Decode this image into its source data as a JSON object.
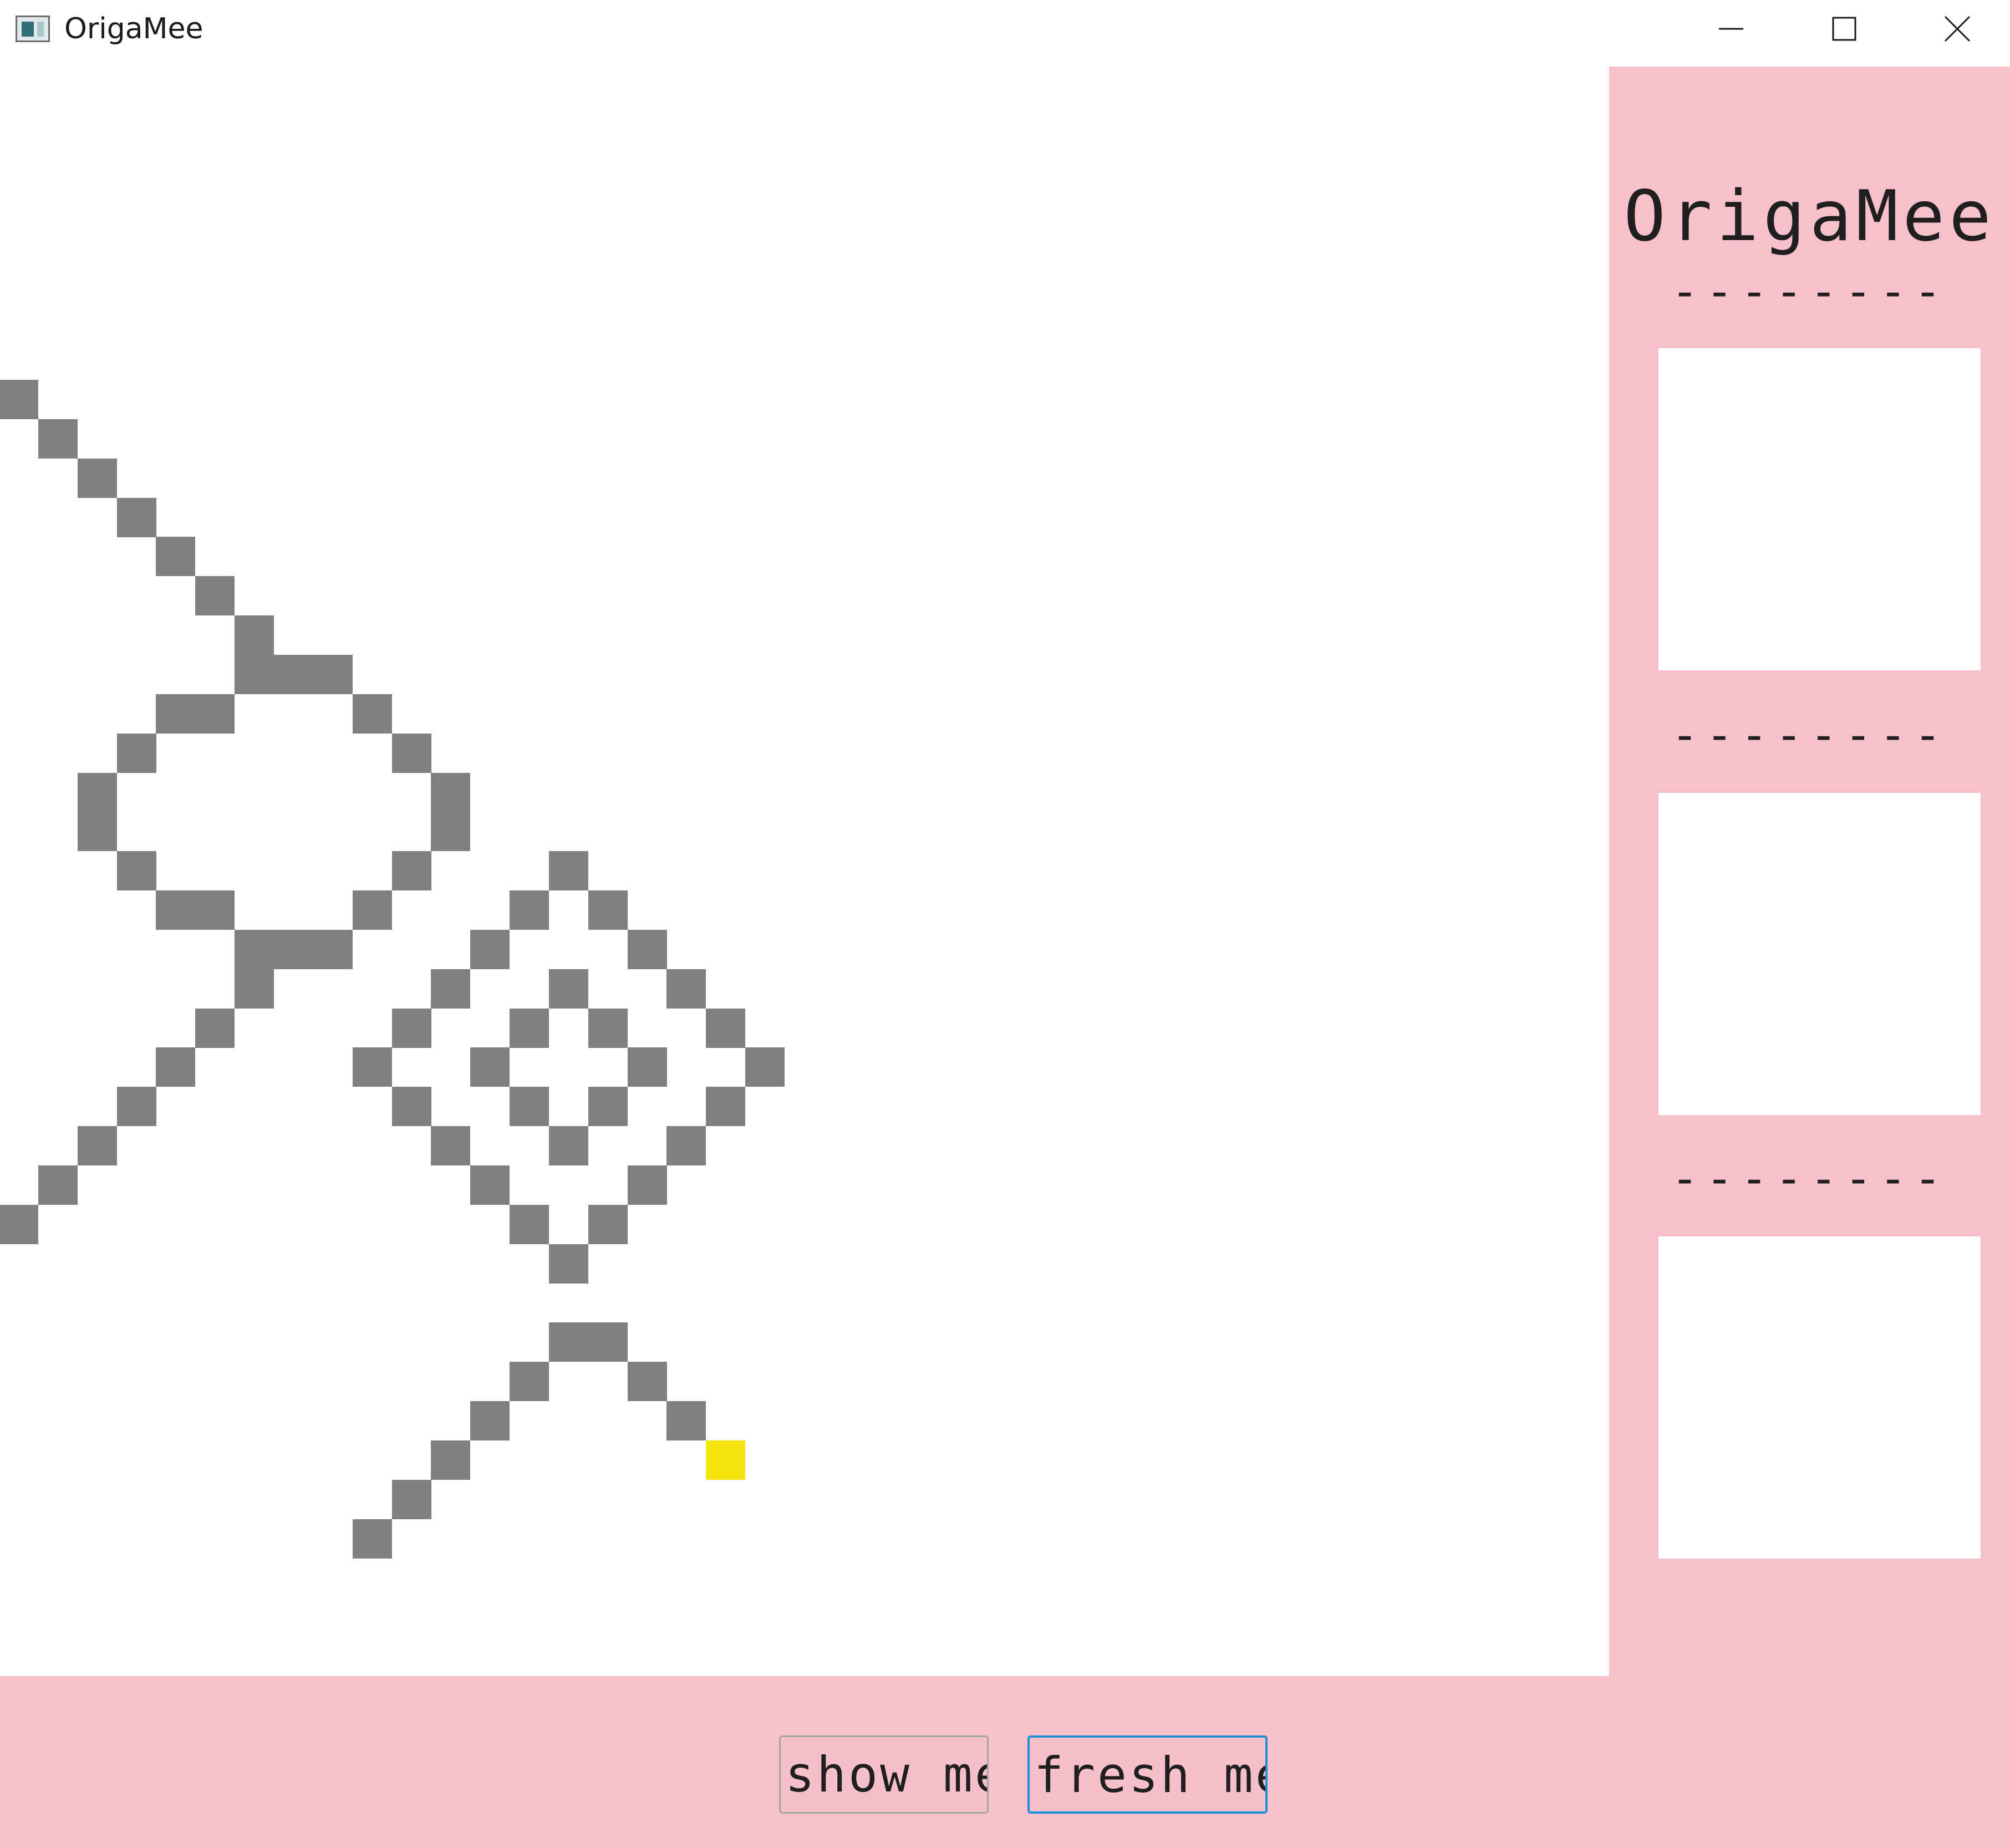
{
  "window": {
    "title": "OrigaMee",
    "controls": [
      "minimize-icon",
      "maximize-icon",
      "close-icon"
    ]
  },
  "sidebar": {
    "brand": "OrigaMee",
    "divider": "--------"
  },
  "buttons": {
    "show_label": "show me",
    "fresh_label": "fresh me"
  },
  "colors": {
    "accent": "#f8c0cb",
    "tile": "#808080",
    "highlight": "#f5e50e"
  },
  "grid": {
    "gray_cells": [
      [
        0,
        6
      ],
      [
        1,
        7
      ],
      [
        2,
        8
      ],
      [
        3,
        9
      ],
      [
        4,
        10
      ],
      [
        5,
        11
      ],
      [
        6,
        12
      ],
      [
        6,
        13
      ],
      [
        7,
        13
      ],
      [
        8,
        13
      ],
      [
        4,
        14
      ],
      [
        5,
        14
      ],
      [
        9,
        14
      ],
      [
        3,
        15
      ],
      [
        10,
        15
      ],
      [
        2,
        16
      ],
      [
        11,
        16
      ],
      [
        2,
        17
      ],
      [
        11,
        17
      ],
      [
        3,
        18
      ],
      [
        10,
        18
      ],
      [
        4,
        19
      ],
      [
        5,
        19
      ],
      [
        9,
        19
      ],
      [
        6,
        20
      ],
      [
        7,
        20
      ],
      [
        8,
        20
      ],
      [
        6,
        21
      ],
      [
        5,
        22
      ],
      [
        4,
        23
      ],
      [
        3,
        24
      ],
      [
        2,
        25
      ],
      [
        1,
        26
      ],
      [
        0,
        27
      ],
      [
        14,
        18
      ],
      [
        13,
        19
      ],
      [
        15,
        19
      ],
      [
        12,
        20
      ],
      [
        16,
        20
      ],
      [
        11,
        21
      ],
      [
        14,
        21
      ],
      [
        17,
        21
      ],
      [
        10,
        22
      ],
      [
        13,
        22
      ],
      [
        15,
        22
      ],
      [
        18,
        22
      ],
      [
        9,
        23
      ],
      [
        12,
        23
      ],
      [
        16,
        23
      ],
      [
        19,
        23
      ],
      [
        10,
        24
      ],
      [
        13,
        24
      ],
      [
        15,
        24
      ],
      [
        18,
        24
      ],
      [
        11,
        25
      ],
      [
        14,
        25
      ],
      [
        17,
        25
      ],
      [
        12,
        26
      ],
      [
        16,
        26
      ],
      [
        13,
        27
      ],
      [
        15,
        27
      ],
      [
        14,
        28
      ],
      [
        14,
        30
      ],
      [
        15,
        30
      ],
      [
        13,
        31
      ],
      [
        16,
        31
      ],
      [
        12,
        32
      ],
      [
        17,
        32
      ],
      [
        11,
        33
      ],
      [
        10,
        34
      ],
      [
        9,
        35
      ]
    ],
    "highlight_cells": [
      [
        18,
        33
      ]
    ]
  }
}
